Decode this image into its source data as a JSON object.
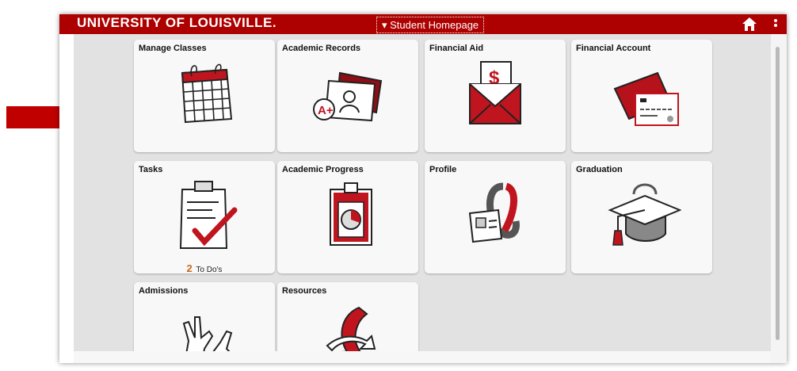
{
  "header": {
    "logo_text": "UNIVERSITY OF LOUISVILLE.",
    "page_selector": "▾ Student Homepage",
    "home_icon": "home-icon",
    "more_icon": "more-vertical-icon"
  },
  "colors": {
    "brand_red": "#ad0000",
    "tile_bg": "#f8f8f8",
    "content_bg": "#e2e2e2",
    "arrow_red": "#c00000",
    "todo_count": "#c8691c"
  },
  "tiles": [
    {
      "title": "Manage Classes",
      "icon": "calendar-icon"
    },
    {
      "title": "Academic Records",
      "icon": "academic-record-icon"
    },
    {
      "title": "Financial Aid",
      "icon": "envelope-dollar-icon"
    },
    {
      "title": "Financial Account",
      "icon": "credit-card-icon"
    },
    {
      "title": "Tasks",
      "icon": "clipboard-check-icon",
      "count": "2",
      "subtitle": "To Do's"
    },
    {
      "title": "Academic Progress",
      "icon": "clipboard-chart-icon"
    },
    {
      "title": "Profile",
      "icon": "id-badge-icon"
    },
    {
      "title": "Graduation",
      "icon": "graduation-cap-icon"
    },
    {
      "title": "Admissions",
      "icon": "hands-icon"
    },
    {
      "title": "Resources",
      "icon": "ribbon-arrows-icon"
    }
  ],
  "annotation": {
    "icon": "pointer-arrow-icon"
  }
}
